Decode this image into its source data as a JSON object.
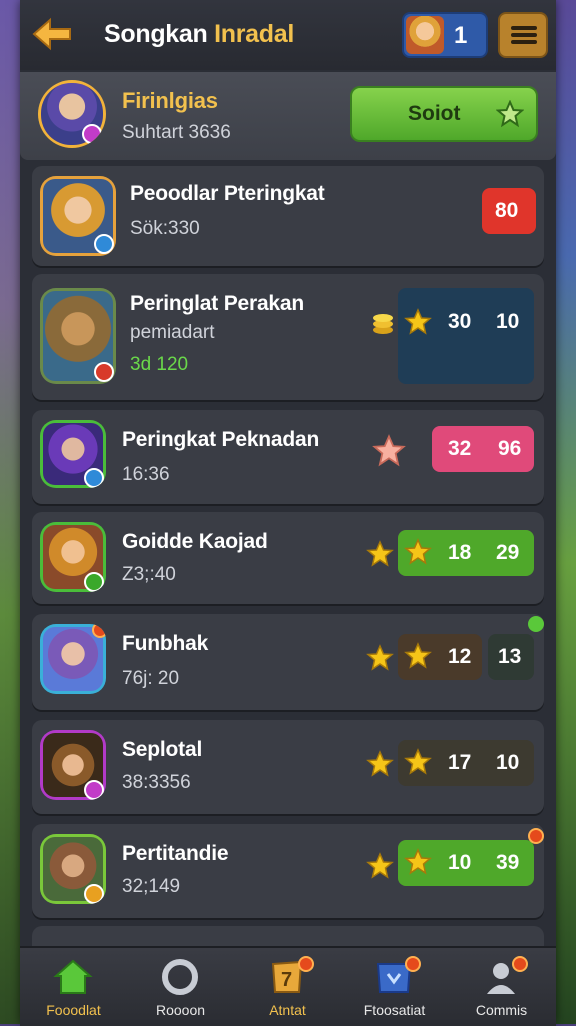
{
  "header": {
    "title_main": "Songkan",
    "title_accent": "Inradal",
    "user_level": "1"
  },
  "me": {
    "name": "Firinlgias",
    "sub": "Suhtart 3636",
    "sort_label": "Soiot"
  },
  "rows": [
    {
      "name": "Peoodlar Pteringkat",
      "sub": "Sök:330",
      "pills": [
        "80"
      ]
    },
    {
      "name": "Peringlat Perakan",
      "sub": "pemiadart",
      "sub2": "3d 120",
      "pills": [
        "30",
        "10"
      ]
    },
    {
      "name": "Peringkat Peknadan",
      "sub": "16:36",
      "pills": [
        "32",
        "96"
      ]
    },
    {
      "name": "Goidde Kaojad",
      "sub": "Z3;:40",
      "pills": [
        "18",
        "29"
      ]
    },
    {
      "name": "Funbhak",
      "sub": "76j: 20",
      "pills": [
        "12",
        "13"
      ]
    },
    {
      "name": "Seplotal",
      "sub": "38:3356",
      "pills": [
        "17",
        "10"
      ]
    },
    {
      "name": "Pertitandie",
      "sub": "32;149",
      "pills": [
        "10",
        "39"
      ]
    }
  ],
  "nav": [
    {
      "label": "Fooodlat",
      "icon": "home-icon"
    },
    {
      "label": "Roooon",
      "icon": "ring-icon"
    },
    {
      "label": "Atntat",
      "icon": "trophy-icon"
    },
    {
      "label": "Ftoosatiat",
      "icon": "shield-icon"
    },
    {
      "label": "Commis",
      "icon": "people-icon"
    }
  ],
  "colors": {
    "green": "#4fa82a",
    "red": "#e0352b",
    "pink": "#e04a7a",
    "navy": "#1f3d56",
    "gold": "#f5c518"
  }
}
